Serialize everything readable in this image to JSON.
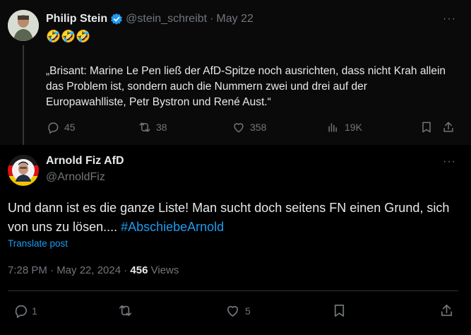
{
  "quoted_tweet": {
    "author_name": "Philip Stein",
    "handle": "@stein_schreibt",
    "separator": "·",
    "date": "May 22",
    "emoji": "🤣🤣🤣",
    "text": "„Brisant: Marine Le Pen ließ der AfD-Spitze noch ausrichten, dass nicht Krah allein das Problem ist, sondern auch die Nummern zwei und drei auf der Europawahlliste, Petr Bystron und René Aust.“",
    "replies": "45",
    "reposts": "38",
    "likes": "358",
    "views": "19K"
  },
  "main_tweet": {
    "author_name": "Arnold Fiz AfD",
    "handle": "@ArnoldFiz",
    "text_before": "Und dann ist es die ganze Liste! Man sucht doch seitens FN einen Grund, sich von uns zu lösen.... ",
    "hashtag": "#AbschiebeArnold",
    "translate": "Translate post",
    "time": "7:28 PM · May 22, 2024 · ",
    "view_count": "456",
    "views_label": " Views",
    "replies": "1",
    "likes": "5"
  },
  "more_label": "···",
  "colors": {
    "accent": "#1d9bf0",
    "muted": "#71767b",
    "background": "#000000",
    "text": "#e7e9ea"
  }
}
